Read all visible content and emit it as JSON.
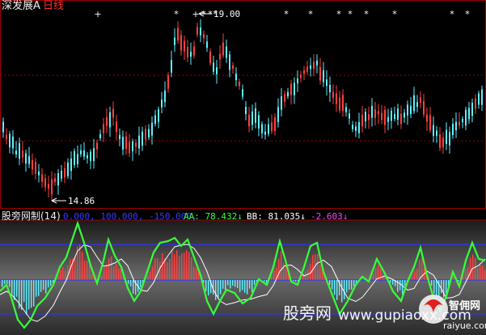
{
  "header": {
    "stock_name": "深发展A",
    "period_label": "日线"
  },
  "price_chart": {
    "high_label": "19.00",
    "low_label": "14.86"
  },
  "indicator": {
    "name_label": "股旁网制(14)",
    "ref_values": "0.000, 100.000, -150.000,",
    "aa_label": "AA: 78.432↓",
    "bb_label": "BB: 81.035↓",
    "neg_label": "-2.603↓"
  },
  "watermarks": {
    "primary": "股旁网",
    "site": "www.gupiaoxx.com",
    "logo": "智佣网",
    "logo_url": "raiyue.com"
  },
  "colors": {
    "background": "#000000",
    "up_candle": "#ff4040",
    "down_candle": "#5ff0ff",
    "grid": "#a00000",
    "indicator_main": "#39ff39",
    "indicator_signal": "#ffffff",
    "ref_line": "#3030ff"
  },
  "chart_data": [
    {
      "type": "candlestick",
      "title": "深发展A 日线",
      "annotations": [
        {
          "text": "19.00",
          "meaning": "period high"
        },
        {
          "text": "14.86",
          "meaning": "period low"
        }
      ]
    },
    {
      "type": "line",
      "title": "股旁网制(14)",
      "series": [
        {
          "name": "AA",
          "last_value": 78.432
        },
        {
          "name": "BB",
          "last_value": 81.035
        }
      ],
      "reference_levels": [
        0,
        100,
        -150
      ],
      "difference_value": -2.603
    }
  ]
}
